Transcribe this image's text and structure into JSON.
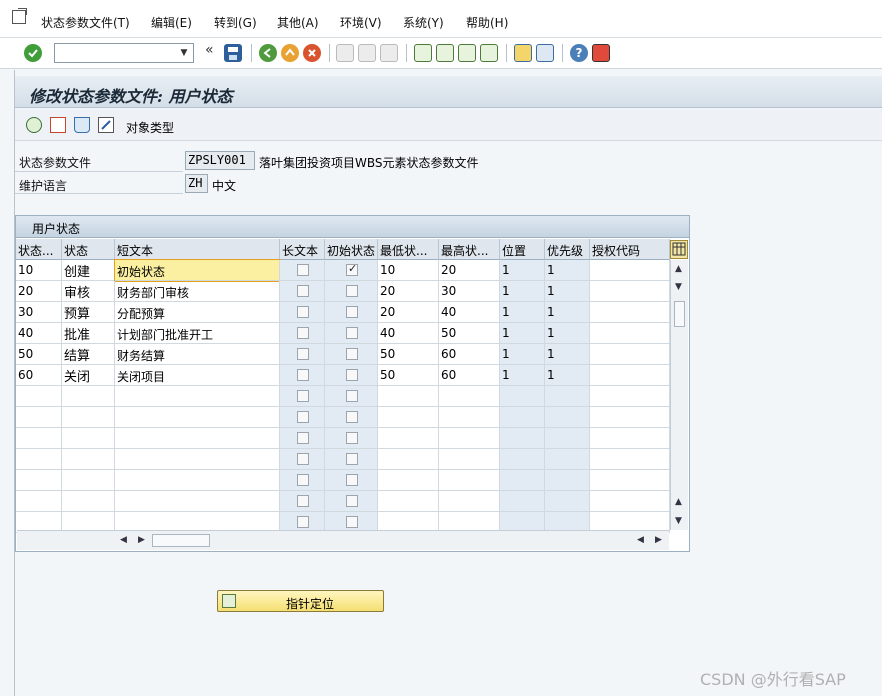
{
  "menu": {
    "items": [
      "状态参数文件(T)",
      "编辑(E)",
      "转到(G)",
      "其他(A)",
      "环境(V)",
      "系统(Y)",
      "帮助(H)"
    ]
  },
  "toolbar": {
    "command_value": "",
    "back_glyph": "«",
    "icons": [
      "enter-icon",
      "save-icon",
      "back-icon",
      "exit-icon",
      "cancel-icon",
      "print-icon",
      "find-icon",
      "find-next-icon",
      "first-page-icon",
      "prev-page-icon",
      "next-page-icon",
      "last-page-icon",
      "create-session-icon",
      "shortcut-icon",
      "help-icon",
      "customize-layout-icon"
    ]
  },
  "page": {
    "title": "修改状态参数文件: 用户状态",
    "object_type_label": "对象类型"
  },
  "header": {
    "profile_label": "状态参数文件",
    "profile_value": "ZPSLY001",
    "profile_desc": "落叶集团投资项目WBS元素状态参数文件",
    "lang_label": "维护语言",
    "lang_value": "ZH",
    "lang_desc": "中文"
  },
  "table": {
    "title": "用户状态",
    "columns": [
      "状态...",
      "状态",
      "短文本",
      "长文本",
      "初始状态",
      "最低状...",
      "最高状...",
      "位置",
      "优先级",
      "授权代码"
    ],
    "rows": [
      {
        "num": "10",
        "status": "创建",
        "text": "初始状态",
        "long": false,
        "init": true,
        "low": "10",
        "high": "20",
        "pos": "1",
        "prio": "1",
        "auth": ""
      },
      {
        "num": "20",
        "status": "审核",
        "text": "财务部门审核",
        "long": false,
        "init": false,
        "low": "20",
        "high": "30",
        "pos": "1",
        "prio": "1",
        "auth": ""
      },
      {
        "num": "30",
        "status": "预算",
        "text": "分配预算",
        "long": false,
        "init": false,
        "low": "20",
        "high": "40",
        "pos": "1",
        "prio": "1",
        "auth": ""
      },
      {
        "num": "40",
        "status": "批准",
        "text": "计划部门批准开工",
        "long": false,
        "init": false,
        "low": "40",
        "high": "50",
        "pos": "1",
        "prio": "1",
        "auth": ""
      },
      {
        "num": "50",
        "status": "结算",
        "text": "财务结算",
        "long": false,
        "init": false,
        "low": "50",
        "high": "60",
        "pos": "1",
        "prio": "1",
        "auth": ""
      },
      {
        "num": "60",
        "status": "关闭",
        "text": "关闭项目",
        "long": false,
        "init": false,
        "low": "50",
        "high": "60",
        "pos": "1",
        "prio": "1",
        "auth": ""
      }
    ],
    "empty_rows": 7
  },
  "button": {
    "label": "指针定位"
  },
  "watermark": "CSDN @外行看SAP"
}
